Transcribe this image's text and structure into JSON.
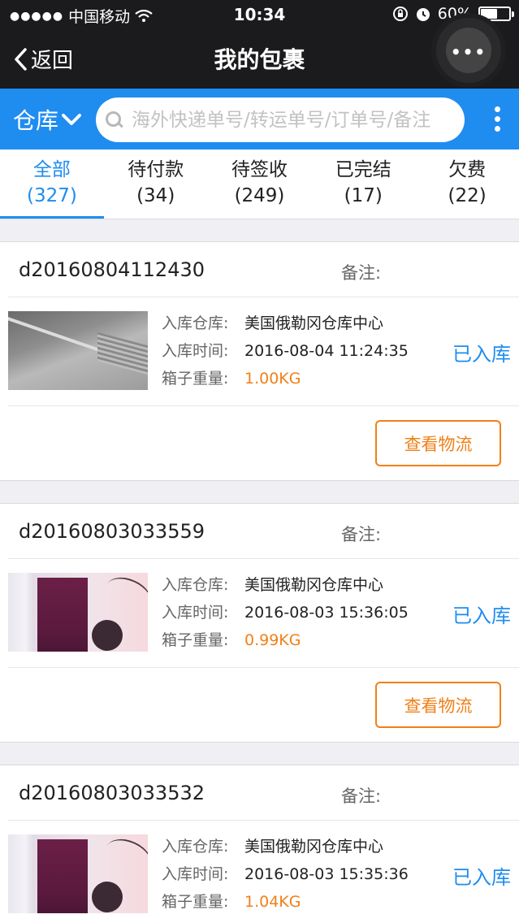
{
  "status_bar": {
    "signal_dots": "●●●●●",
    "carrier": "中国移动",
    "time": "10:34",
    "battery_text": "60%",
    "battery_level": 0.6
  },
  "nav": {
    "back_label": "返回",
    "title": "我的包裹"
  },
  "search_bar": {
    "warehouse_label": "仓库",
    "placeholder": "海外快递单号/转运单号/订单号/备注"
  },
  "tabs": [
    {
      "label": "全部",
      "count": "(327)",
      "active": true
    },
    {
      "label": "待付款",
      "count": "(34)",
      "active": false
    },
    {
      "label": "待签收",
      "count": "(249)",
      "active": false
    },
    {
      "label": "已完结",
      "count": "(17)",
      "active": false
    },
    {
      "label": "欠费",
      "count": "(22)",
      "active": false
    }
  ],
  "labels": {
    "remark": "备注:",
    "warehouse_key": "入库仓库:",
    "time_key": "入库时间:",
    "weight_key": "箱子重量:",
    "track_button": "查看物流"
  },
  "packages": [
    {
      "order_no": "d20160804112430",
      "warehouse": "美国俄勒冈仓库中心",
      "time": "2016-08-04 11:24:35",
      "weight": "1.00KG",
      "status": "已入库"
    },
    {
      "order_no": "d20160803033559",
      "warehouse": "美国俄勒冈仓库中心",
      "time": "2016-08-03 15:36:05",
      "weight": "0.99KG",
      "status": "已入库"
    },
    {
      "order_no": "d20160803033532",
      "warehouse": "美国俄勒冈仓库中心",
      "time": "2016-08-03 15:35:36",
      "weight": "1.04KG",
      "status": "已入库"
    }
  ],
  "colors": {
    "accent_blue": "#1f8cf0",
    "accent_orange": "#f08019",
    "nav_dark": "#1b1b1d"
  }
}
